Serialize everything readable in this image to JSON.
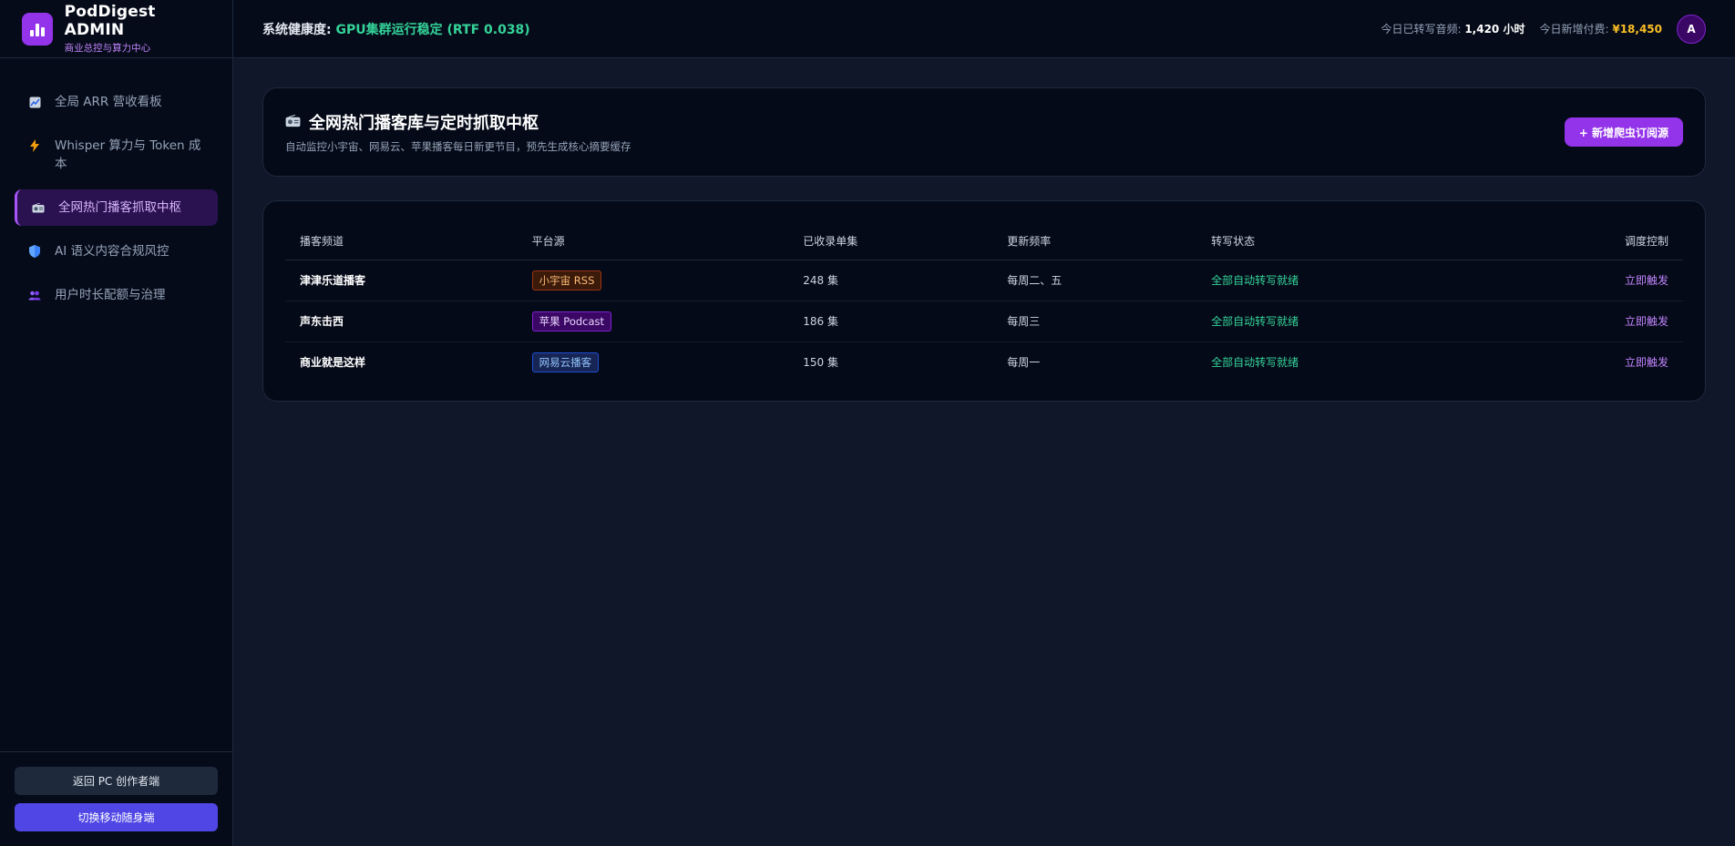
{
  "brand": {
    "name": "PodDigest ADMIN",
    "subtitle": "商业总控与算力中心",
    "logo_icon": "bar-chart-icon",
    "accent_color": "#9333ea"
  },
  "sidebar": {
    "items": [
      {
        "label": "全局 ARR 营收看板",
        "icon": "trend-chart-icon",
        "active": false
      },
      {
        "label": "Whisper 算力与 Token 成本",
        "icon": "lightning-icon",
        "active": false
      },
      {
        "label": "全网热门播客抓取中枢",
        "icon": "radio-icon",
        "active": true
      },
      {
        "label": "AI 语义内容合规风控",
        "icon": "shield-icon",
        "active": false
      },
      {
        "label": "用户时长配额与治理",
        "icon": "users-icon",
        "active": false
      }
    ],
    "footer": {
      "back_label": "返回 PC 创作者端",
      "mobile_label": "切换移动随身端"
    }
  },
  "topbar": {
    "health_label": "系统健康度:",
    "health_value": "GPU集群运行稳定 (RTF 0.038)",
    "transcribe_label": "今日已转写音频:",
    "transcribe_value": "1,420 小时",
    "revenue_label": "今日新增付费:",
    "revenue_value": "¥18,450",
    "avatar_initial": "A"
  },
  "page": {
    "title": "全网热门播客库与定时抓取中枢",
    "title_icon": "radio-icon",
    "description": "自动监控小宇宙、网易云、苹果播客每日新更节目，预先生成核心摘要缓存",
    "add_button": "+ 新增爬虫订阅源"
  },
  "table": {
    "columns": [
      "播客频道",
      "平台源",
      "已收录单集",
      "更新频率",
      "转写状态",
      "调度控制"
    ],
    "rows": [
      {
        "channel": "津津乐道播客",
        "platform": "小宇宙 RSS",
        "platform_color": "orange",
        "episodes": "248 集",
        "frequency": "每周二、五",
        "status": "全部自动转写就绪",
        "action": "立即触发"
      },
      {
        "channel": "声东击西",
        "platform": "苹果 Podcast",
        "platform_color": "purple",
        "episodes": "186 集",
        "frequency": "每周三",
        "status": "全部自动转写就绪",
        "action": "立即触发"
      },
      {
        "channel": "商业就是这样",
        "platform": "网易云播客",
        "platform_color": "blue",
        "episodes": "150 集",
        "frequency": "每周一",
        "status": "全部自动转写就绪",
        "action": "立即触发"
      }
    ]
  }
}
